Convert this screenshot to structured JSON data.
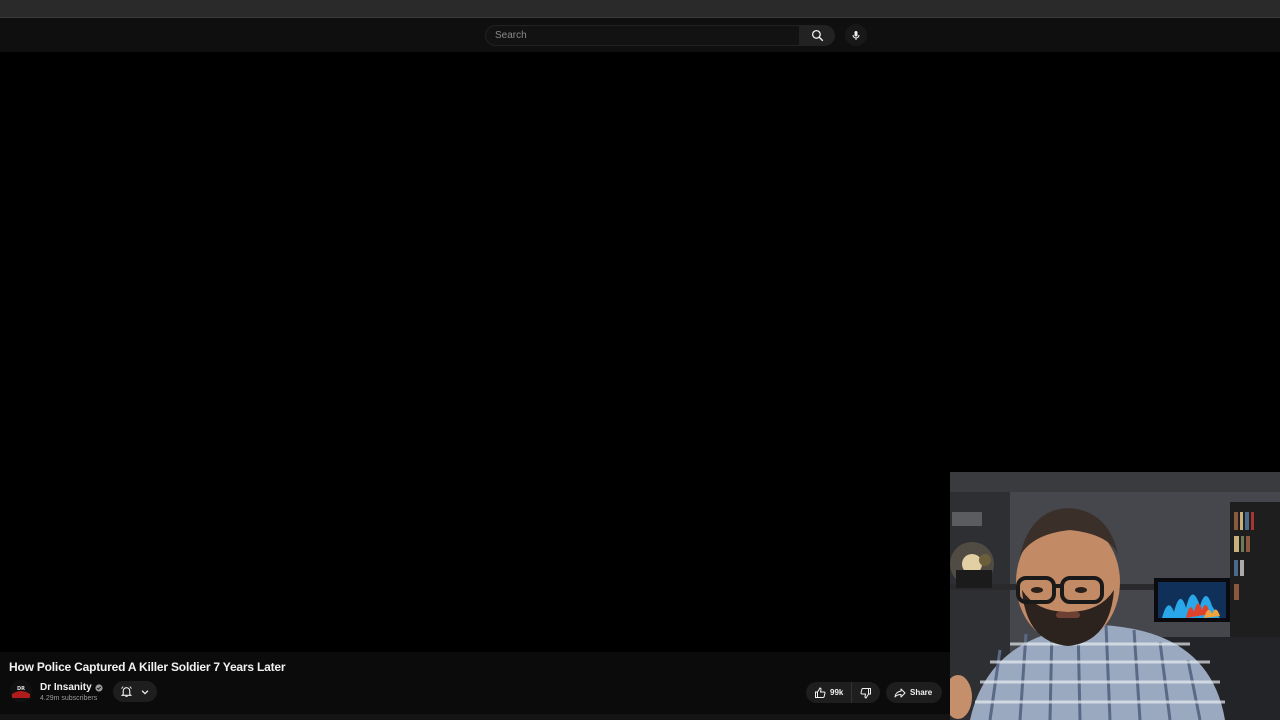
{
  "masthead": {
    "search": {
      "placeholder": "Search",
      "search_icon": "search-icon",
      "mic_icon": "microphone-icon"
    }
  },
  "video": {
    "title": "How Police Captured A Killer Soldier 7 Years Later",
    "channel": {
      "name": "Dr Insanity",
      "subscribers": "4.29m subscribers",
      "avatar_text": "DR",
      "verified_icon": "verified-check-icon"
    },
    "subscribe": {
      "bell_icon": "notification-bell-icon",
      "chevron_icon": "chevron-down-icon"
    },
    "actions": {
      "like_count": "99k",
      "like_icon": "thumbs-up-icon",
      "dislike_icon": "thumbs-down-icon",
      "share_label": "Share",
      "share_icon": "share-arrow-icon"
    }
  },
  "colors": {
    "background": "#000000",
    "masthead": "#0f0f0f",
    "pill": "#1e1e1e",
    "text": "#f1f1f1",
    "muted_text": "#9a9a9a"
  }
}
